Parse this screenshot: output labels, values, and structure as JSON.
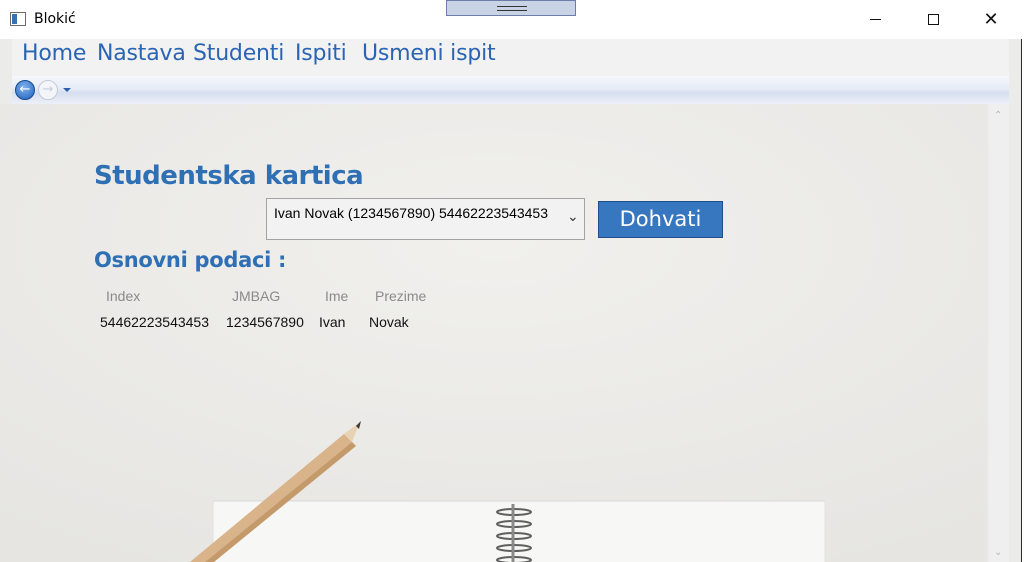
{
  "window": {
    "title": "Blokić",
    "controls": {
      "minimize": "minimize",
      "maximize": "maximize",
      "close": "✕"
    }
  },
  "menu": {
    "items": [
      {
        "label": "Home"
      },
      {
        "label": "Nastava"
      },
      {
        "label": "Studenti"
      },
      {
        "label": "Ispiti"
      },
      {
        "label": "Usmeni ispit"
      }
    ]
  },
  "nav": {
    "back_icon": "back-arrow-icon",
    "forward_icon": "forward-arrow-icon",
    "history_icon": "chevron-down-icon"
  },
  "page": {
    "title": "Studentska kartica",
    "student_select": {
      "value": "Ivan Novak (1234567890) 54462223543453"
    },
    "fetch_button": "Dohvati",
    "section_title": "Osnovni podaci :",
    "table": {
      "headers": [
        "Index",
        "JMBAG",
        "Ime",
        "Prezime"
      ],
      "row": [
        "54462223543453",
        "1234567890",
        "Ivan",
        "Novak"
      ]
    }
  },
  "colors": {
    "accent": "#2f6fb4",
    "button": "#3777c0",
    "menu_text": "#2a64b3"
  }
}
